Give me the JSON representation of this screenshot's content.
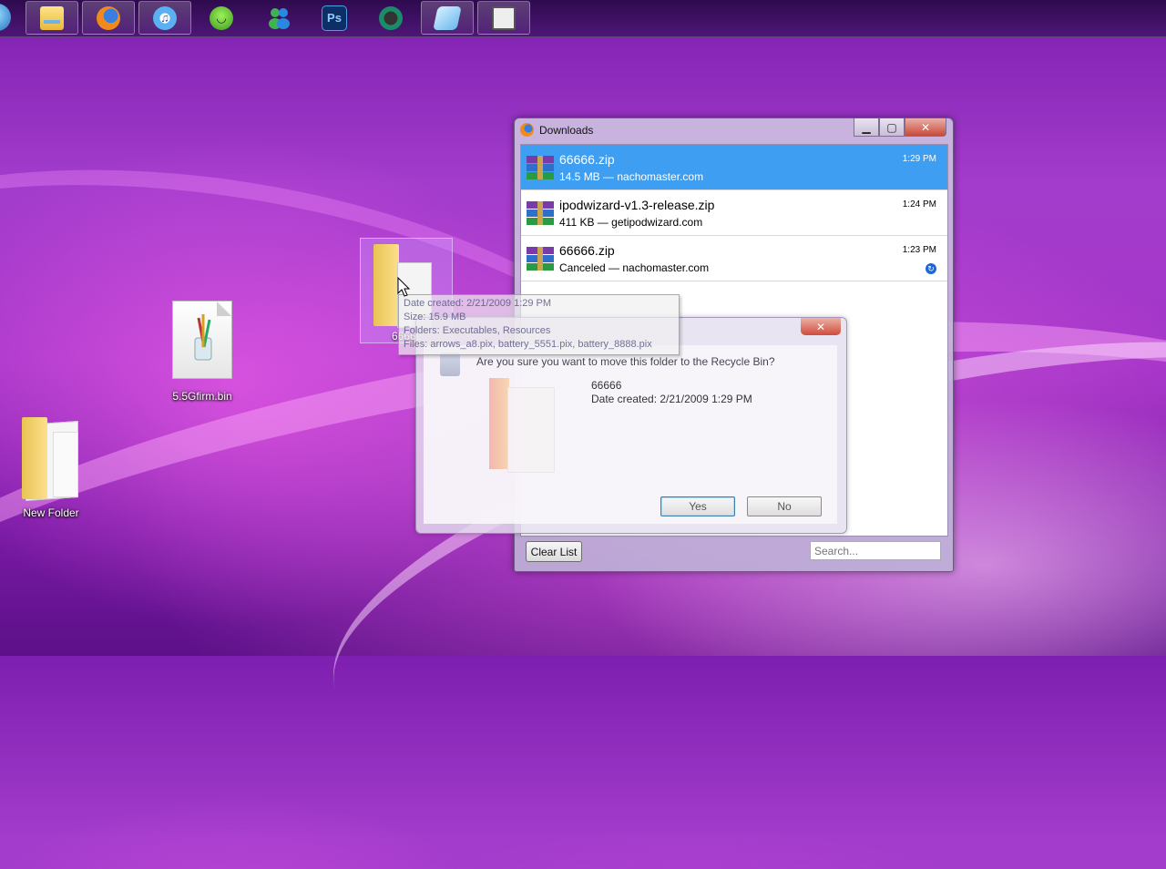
{
  "taskbar": {
    "items": [
      {
        "name": "Windows Explorer",
        "icon": "folder-icon"
      },
      {
        "name": "Firefox",
        "icon": "firefox-icon"
      },
      {
        "name": "iTunes",
        "icon": "itunes-icon"
      },
      {
        "name": "Messenger buddy",
        "icon": "frog-icon"
      },
      {
        "name": "Windows Live Messenger",
        "icon": "messenger-icon"
      },
      {
        "name": "Photoshop",
        "icon": "photoshop-icon",
        "label": "Ps"
      },
      {
        "name": "Media Center",
        "icon": "media-center-icon"
      },
      {
        "name": "Notepad",
        "icon": "notepad-icon"
      },
      {
        "name": "Snipping Tool",
        "icon": "snipping-tool-icon"
      }
    ]
  },
  "desktop": {
    "icons": [
      {
        "label": "5.5Gfirm.bin",
        "icon": "bin-file-icon"
      },
      {
        "label": "New Folder",
        "icon": "folder-icon"
      },
      {
        "label": "66666",
        "icon": "folder-icon"
      }
    ]
  },
  "downloads_window": {
    "title": "Downloads",
    "items": [
      {
        "name": "66666.zip",
        "status": "14.5 MB — nachomaster.com",
        "time": "1:29 PM",
        "selected": true
      },
      {
        "name": "ipodwizard-v1.3-release.zip",
        "status": "411 KB — getipodwizard.com",
        "time": "1:24 PM",
        "selected": false
      },
      {
        "name": "66666.zip",
        "status": "Canceled — nachomaster.com",
        "time": "1:23 PM",
        "selected": false
      }
    ],
    "clear_label": "Clear List",
    "search_placeholder": "Search..."
  },
  "recycle_dialog": {
    "question": "Are you sure you want to move this folder to the Recycle Bin?",
    "name": "66666",
    "date": "Date created: 2/21/2009 1:29 PM",
    "yes_label": "Yes",
    "no_label": "No"
  },
  "tooltip": {
    "lines": [
      "Date created: 2/21/2009 1:29 PM",
      "Size: 15.9 MB",
      "Folders: Executables, Resources",
      "Files: arrows_a8.pix, battery_5551.pix, battery_8888.pix"
    ]
  },
  "colors": {
    "selection": "#3d9ef2",
    "wallpaper": "#a33ccc"
  }
}
